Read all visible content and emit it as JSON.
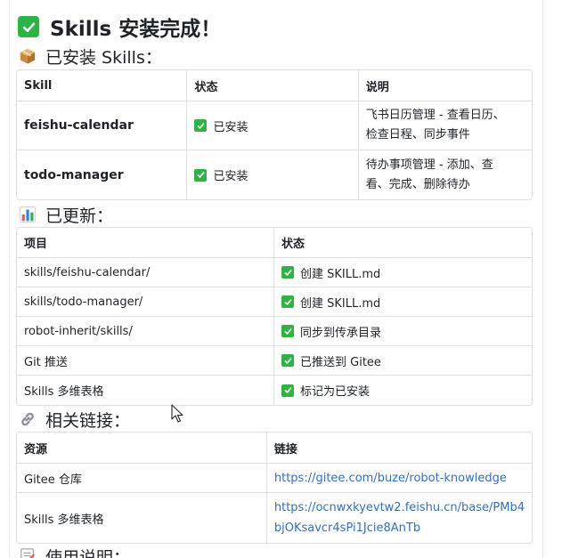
{
  "title": "Skills 安装完成！",
  "sections": {
    "installed": {
      "heading": "已安装 Skills：",
      "headers": [
        "Skill",
        "状态",
        "说明"
      ],
      "rows": [
        {
          "skill": "feishu-calendar",
          "status": "已安装",
          "desc_line1": "飞书日历管理 - 查看日历、",
          "desc_line2": "检查日程、同步事件"
        },
        {
          "skill": "todo-manager",
          "status": "已安装",
          "desc_line1": "待办事项管理 - 添加、查",
          "desc_line2": "看、完成、删除待办"
        }
      ]
    },
    "updated": {
      "heading": "已更新：",
      "headers": [
        "项目",
        "状态"
      ],
      "rows": [
        {
          "item": "skills/feishu-calendar/",
          "status": "创建 SKILL.md"
        },
        {
          "item": "skills/todo-manager/",
          "status": "创建 SKILL.md"
        },
        {
          "item": "robot-inherit/skills/",
          "status": "同步到传承目录"
        },
        {
          "item": "Git 推送",
          "status": "已推送到 Gitee"
        },
        {
          "item": "Skills 多维表格",
          "status": "标记为已安装"
        }
      ]
    },
    "links": {
      "heading": "相关链接：",
      "headers": [
        "资源",
        "链接"
      ],
      "rows": [
        {
          "resource": "Gitee 仓库",
          "url_line1": "https://gitee.com/buze/robot-knowledge",
          "url_line2": ""
        },
        {
          "resource": "Skills 多维表格",
          "url_line1": "https://ocnwxkyevtw2.feishu.cn/base/PMb4",
          "url_line2": "bjOKsavcr4sPi1Jcie8AnTb"
        }
      ]
    },
    "usage": {
      "heading": "使用说明："
    }
  },
  "colors": {
    "check": "#2fb344",
    "link": "#3370b7",
    "border": "#dee0e3"
  },
  "icons": {
    "title": "check-box-icon",
    "installed": "package-icon",
    "updated": "bar-chart-icon",
    "links": "link-icon",
    "usage": "memo-icon"
  }
}
